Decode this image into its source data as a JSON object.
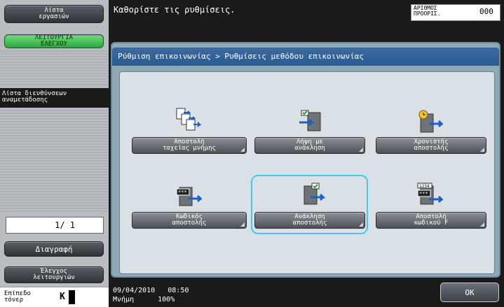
{
  "sidebar": {
    "job_list": "Λίστα\nεργασιών",
    "control_function": "ΛΕΙΤΟΥΡΓΙΑ\nΕΛΕΓΧΟΥ",
    "address_list": "Λίστα διευθύνσεων\nαναμετάδοσης",
    "page_indicator": "1/ 1",
    "delete": "Διαγραφή",
    "check_functions": "Έλεγχος\nλειτουργιών",
    "toner_label": "Επίπεδο\nτόνερ",
    "toner_color": "K"
  },
  "header": {
    "message": "Καθορίστε τις ρυθμίσεις.",
    "counter_label": "ΑΡΙΘΜΟΣ\nΠΡΟΟΡΙΣ.",
    "counter_value": "000"
  },
  "breadcrumb": "Ρύθμιση επικοινωνίας > Ρυθμίσεις μεθόδου επικοινωνίας",
  "functions": [
    {
      "label": "Αποστολή\nταχείας μνήμης",
      "icon": "quick-memory-tx-icon"
    },
    {
      "label": "Λήψη με\nανάκληση",
      "icon": "polling-rx-icon"
    },
    {
      "label": "Χρονιστής\nαποστολής",
      "icon": "timer-tx-icon"
    },
    {
      "label": "Κωδικός\nαποστολής",
      "icon": "password-tx-icon"
    },
    {
      "label": "Ανάκληση\nαποστολής",
      "icon": "polling-tx-icon",
      "selected": true
    },
    {
      "label": "Αποστολή\nκωδικού F",
      "icon": "f-code-tx-icon"
    }
  ],
  "footer": {
    "datetime": "09/04/2010   08:50",
    "memory_label": "Μνήμη",
    "memory_value": "100%",
    "ok": "OK"
  },
  "colors": {
    "accent_green": "#2fa13f",
    "breadcrumb_blue": "#2b5a8f",
    "selection_cyan": "#49c7e3"
  }
}
